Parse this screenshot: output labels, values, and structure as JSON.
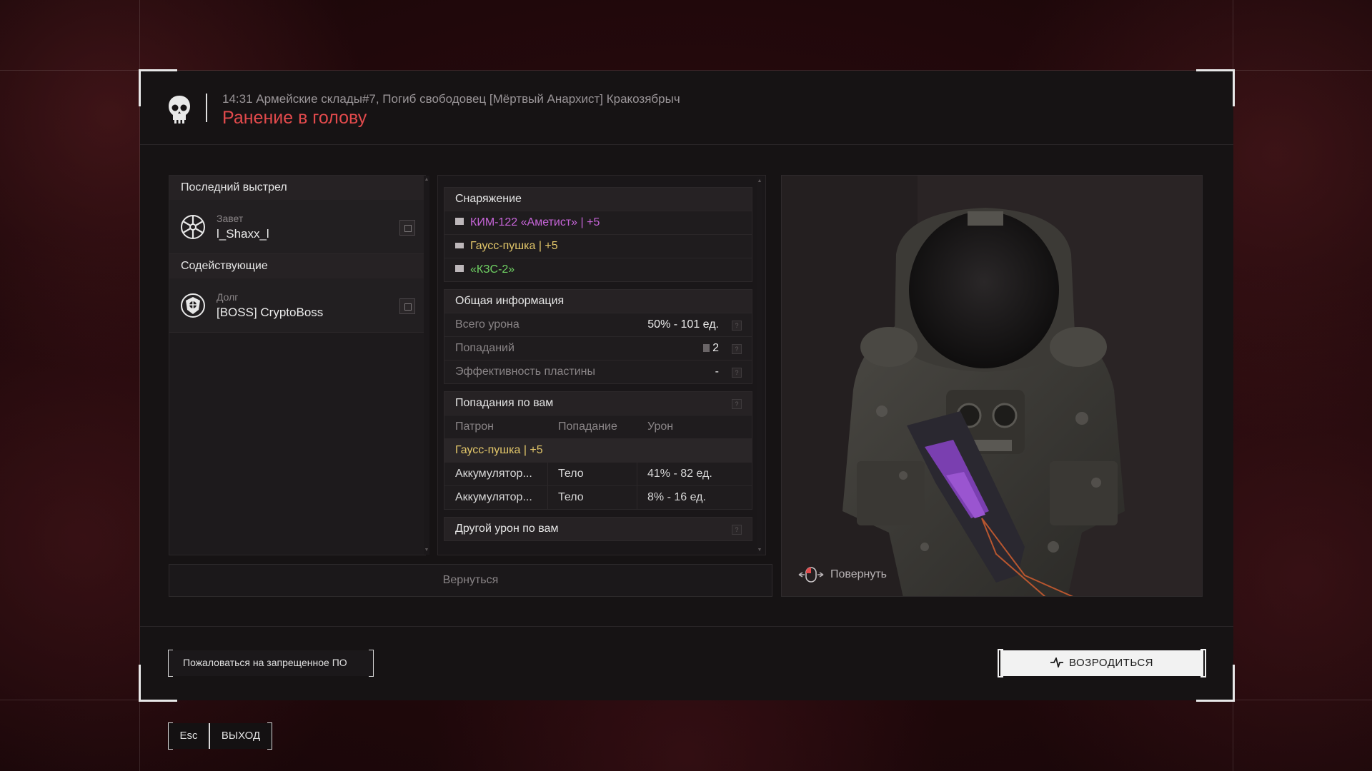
{
  "header": {
    "event_line": "14:31 Армейские склады#7, Погиб свободовец [Мёртвый Анархист] Кракозябрыч",
    "death_cause": "Ранение в голову"
  },
  "left": {
    "last_shot_title": "Последний выстрел",
    "killer": {
      "faction": "Завет",
      "name": "l_Shaxx_l"
    },
    "assist_title": "Содействующие",
    "assistant": {
      "faction": "Долг",
      "name": "[BOSS] CryptoBoss"
    }
  },
  "equipment": {
    "title": "Снаряжение",
    "items": [
      {
        "name": "КИМ-122 «Аметист» | +5",
        "rarity_color": "#c765d9",
        "icon": "armor-icon"
      },
      {
        "name": "Гаусс-пушка | +5",
        "rarity_color": "#e3c76a",
        "icon": "gun-icon"
      },
      {
        "name": "«КЗС-2»",
        "rarity_color": "#6fd063",
        "icon": "helmet-icon"
      }
    ]
  },
  "general": {
    "title": "Общая информация",
    "rows": [
      {
        "label": "Всего урона",
        "value": "50% - 101 ед."
      },
      {
        "label": "Попаданий",
        "value": "2"
      },
      {
        "label": "Эффективность пластины",
        "value": "-"
      }
    ]
  },
  "hits": {
    "title": "Попадания по вам",
    "columns": [
      "Патрон",
      "Попадание",
      "Урон"
    ],
    "weapon": "Гаусс-пушка | +5",
    "rows": [
      {
        "ammo": "Аккумулятор...",
        "hit": "Тело",
        "damage": "41% - 82 ед."
      },
      {
        "ammo": "Аккумулятор...",
        "hit": "Тело",
        "damage": "8% - 16 ед."
      }
    ]
  },
  "other_damage_title": "Другой урон по вам",
  "back_label": "Вернуться",
  "rotate_label": "Повернуть",
  "report_label": "Пожаловаться на запрещенное ПО",
  "respawn_label": "ВОЗРОДИТЬСЯ",
  "exit": {
    "key": "Esc",
    "label": "ВЫХОД"
  },
  "colors": {
    "accent_red": "#e24a4c",
    "background": "#24090c"
  }
}
